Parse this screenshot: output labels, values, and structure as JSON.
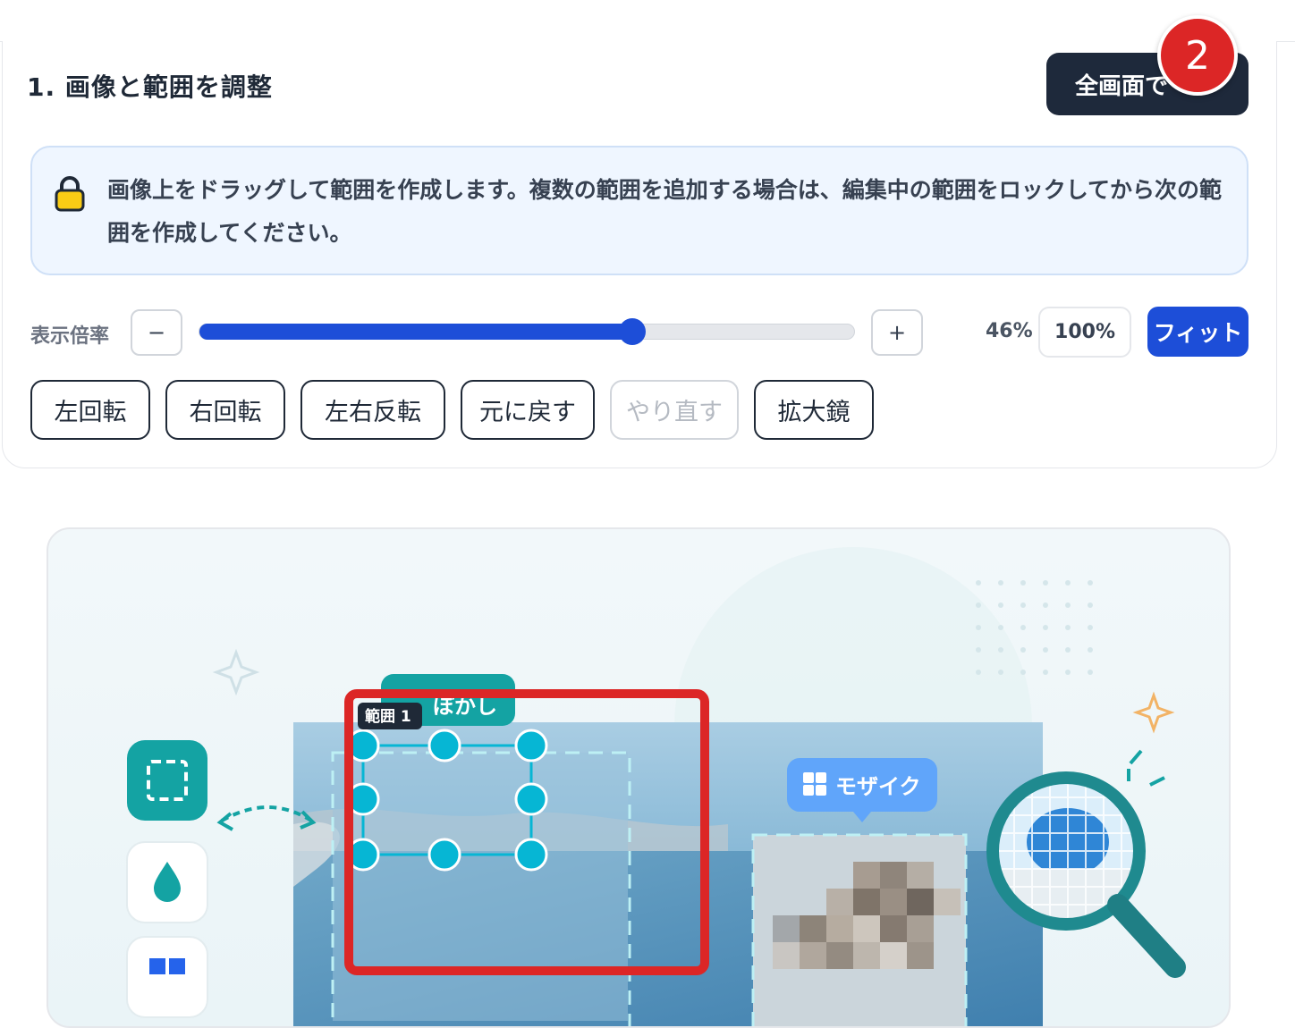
{
  "section": {
    "title": "1. 画像と範囲を調整",
    "fullscreen_label": "全画面で",
    "badge": "2"
  },
  "info": {
    "icon": "lock-icon",
    "text": "画像上をドラッグして範囲を作成します。複数の範囲を追加する場合は、編集中の範囲をロックしてから次の範囲を作成してください。"
  },
  "zoom": {
    "label": "表示倍率",
    "minus": "−",
    "plus": "+",
    "value": "46%",
    "slider_fraction": 0.66,
    "preset_100": "100%",
    "fit": "フィット"
  },
  "tools": [
    {
      "label": "左回転",
      "enabled": true
    },
    {
      "label": "右回転",
      "enabled": true
    },
    {
      "label": "左右反転",
      "enabled": true
    },
    {
      "label": "元に戻す",
      "enabled": true
    },
    {
      "label": "やり直す",
      "enabled": false
    },
    {
      "label": "拡大鏡",
      "enabled": true
    }
  ],
  "preview": {
    "range_tag": "範囲 1",
    "blur_tag": "ぼかし",
    "mosaic_tag": "モザイク"
  },
  "colors": {
    "primary": "#1d4ed8",
    "dark": "#1e293b",
    "teal": "#14a3a3",
    "handle": "#06b6d4",
    "highlight": "#dc2626"
  }
}
